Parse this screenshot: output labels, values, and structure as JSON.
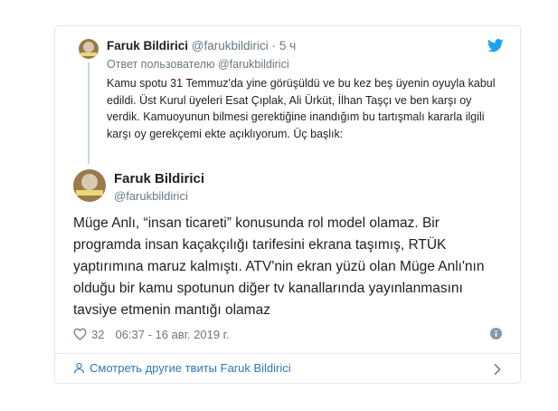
{
  "reply_tweet": {
    "name": "Faruk Bildirici",
    "handle": "@farukbildirici",
    "separator": "·",
    "time": "5 ч",
    "reply_to": "Ответ пользователю @farukbildirici",
    "text": "Kamu spotu 31 Temmuz'da yine görüşüldü ve bu kez beş üyenin oyuyla kabul edildi.  Üst Kurul üyeleri Esat Çıplak, Ali Ürküt, İlhan Taşçı ve ben karşı oy verdik. Kamuoyunun bilmesi gerektiğine inandığım bu tartışmalı kararla ilgili karşı oy gerekçemi ekte açıklıyorum. Üç başlık:"
  },
  "main_tweet": {
    "name": "Faruk Bildirici",
    "handle": "@farukbildirici",
    "text": "Müge Anlı, “insan ticareti” konusunda rol model olamaz. Bir programda insan kaçakçılığı tarifesini ekrana taşımış, RTÜK yaptırımına maruz kalmıştı. ATV'nin ekran yüzü olan Müge Anlı'nın olduğu bir kamu spotunun diğer tv kanallarında yayınlanmasını tavsiye etmenin mantığı olamaz",
    "likes": "32",
    "timestamp": "06:37 - 16 авг. 2019 г."
  },
  "footer": {
    "more_tweets_label": "Смотреть другие твиты Faruk Bildirici"
  },
  "icons": {
    "twitter": "twitter-bird-icon",
    "heart": "heart-icon",
    "info": "info-icon",
    "person": "person-icon",
    "chevron": "chevron-right-icon"
  },
  "colors": {
    "twitter_blue": "#1da1f2",
    "link": "#2b7bb9",
    "secondary_text": "#697882",
    "border": "#e1e8ed"
  }
}
